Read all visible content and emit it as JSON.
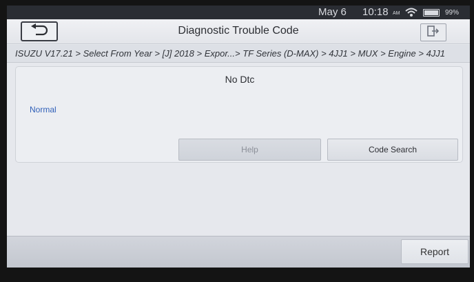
{
  "status_bar": {
    "date": "May 6",
    "time": "10:18",
    "ampm": "AM",
    "battery_level": "99%",
    "wifi_icon": "wifi-icon",
    "battery_icon": "battery-icon"
  },
  "header": {
    "title": "Diagnostic Trouble Code",
    "back_icon": "back-arrow-icon",
    "exit_icon": "exit-icon"
  },
  "breadcrumb": {
    "path": "ISUZU V17.21 > Select From Year > [J] 2018 > Expor...> TF Series (D-MAX) > 4JJ1 > MUX > Engine > 4JJ1"
  },
  "result": {
    "message": "No Dtc",
    "status": "Normal"
  },
  "actions": {
    "help_label": "Help",
    "code_search_label": "Code Search",
    "report_label": "Report"
  }
}
